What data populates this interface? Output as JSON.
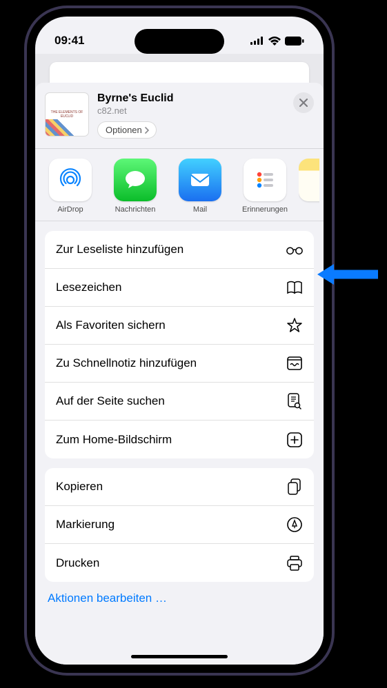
{
  "status": {
    "time": "09:41"
  },
  "header": {
    "title": "Byrne's Euclid",
    "subtitle": "c82.net",
    "options_label": "Optionen",
    "thumb_text": "THE ELEMENTS OF EUCLID"
  },
  "apps": [
    {
      "name": "airdrop",
      "label": "AirDrop",
      "bg": "#ffffff"
    },
    {
      "name": "messages",
      "label": "Nachrichten",
      "bg": "linear-gradient(#5df777,#0bbd2a)"
    },
    {
      "name": "mail",
      "label": "Mail",
      "bg": "linear-gradient(#3fd0ff,#1a6ff0)"
    },
    {
      "name": "reminders",
      "label": "Erinnerungen",
      "bg": "#ffffff"
    },
    {
      "name": "notes",
      "label": "",
      "bg": "linear-gradient(#ffe97a,#ffd93a 30%, #fffcef 30%)"
    }
  ],
  "actions_group1": [
    {
      "name": "reading-list",
      "label": "Zur Leseliste hinzufügen",
      "icon": "glasses"
    },
    {
      "name": "bookmarks",
      "label": "Lesezeichen",
      "icon": "book"
    },
    {
      "name": "favorites",
      "label": "Als Favoriten sichern",
      "icon": "star"
    },
    {
      "name": "quicknote",
      "label": "Zu Schnellnotiz hinzufügen",
      "icon": "note"
    },
    {
      "name": "find",
      "label": "Auf der Seite suchen",
      "icon": "doc-search"
    },
    {
      "name": "homescreen",
      "label": "Zum Home-Bildschirm",
      "icon": "plus-square"
    }
  ],
  "actions_group2": [
    {
      "name": "copy",
      "label": "Kopieren",
      "icon": "docs"
    },
    {
      "name": "markup",
      "label": "Markierung",
      "icon": "markup"
    },
    {
      "name": "print",
      "label": "Drucken",
      "icon": "printer"
    }
  ],
  "edit_link": "Aktionen bearbeiten …"
}
